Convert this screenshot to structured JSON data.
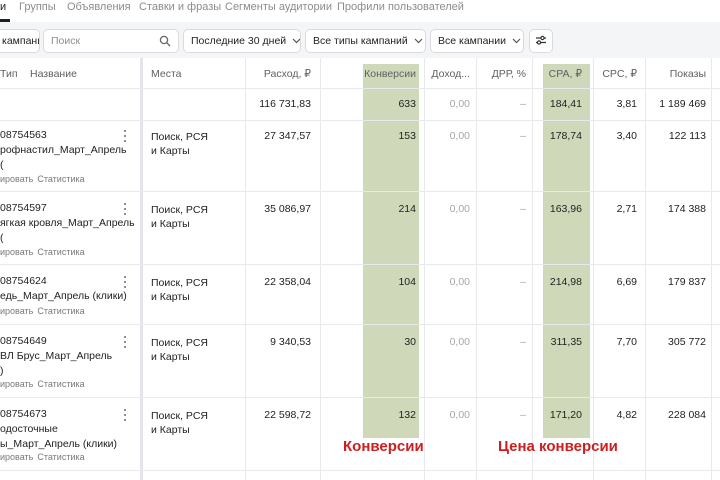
{
  "tabs": [
    {
      "label": "и",
      "active": true
    },
    {
      "label": "Группы"
    },
    {
      "label": "Объявления"
    },
    {
      "label": "Ставки и фразы"
    },
    {
      "label": "Сегменты аудитории"
    },
    {
      "label": "Профили пользователей"
    }
  ],
  "filters": {
    "add_campaign_label": "кампанию",
    "search_placeholder": "Поиск",
    "period_label": "Последние 30 дней",
    "types_label": "Все типы кампаний",
    "campaigns_label": "Все кампании"
  },
  "columns": {
    "type": "Тип",
    "name": "Название",
    "places": "Места",
    "spend": "Расход, ₽",
    "conversions": "Конверсии",
    "income": "Доход...",
    "drr": "ДРР, %",
    "cpa": "CPA, ₽",
    "cpc": "CPC, ₽",
    "impressions": "Показы"
  },
  "totals": {
    "spend": "116 731,83",
    "conversions": "633",
    "income": "0,00",
    "drr": "–",
    "cpa": "184,41",
    "cpc": "3,81",
    "impressions": "1 189 469"
  },
  "rows": [
    {
      "id": "08754563",
      "name_lines": [
        "рофнастил_Март_Апрель",
        "("
      ],
      "link1": "ировать",
      "link2": "Статистика",
      "places": [
        "Поиск, РСЯ",
        "и Карты"
      ],
      "spend": "27 347,57",
      "conversions": "153",
      "income": "0,00",
      "drr": "–",
      "cpa": "178,74",
      "cpc": "3,40",
      "impressions": "122 113"
    },
    {
      "id": "08754597",
      "name_lines": [
        "ягкая кровля_Март_Апрель",
        "("
      ],
      "link1": "ировать",
      "link2": "Статистика",
      "places": [
        "Поиск, РСЯ",
        "и Карты"
      ],
      "spend": "35 086,97",
      "conversions": "214",
      "income": "0,00",
      "drr": "–",
      "cpa": "163,96",
      "cpc": "2,71",
      "impressions": "174 388"
    },
    {
      "id": "08754624",
      "name_lines": [
        "едь_Март_Апрель (клики)"
      ],
      "link1": "ировать",
      "link2": "Статистика",
      "places": [
        "Поиск, РСЯ",
        "и Карты"
      ],
      "spend": "22 358,04",
      "conversions": "104",
      "income": "0,00",
      "drr": "–",
      "cpa": "214,98",
      "cpc": "6,69",
      "impressions": "179 837"
    },
    {
      "id": "08754649",
      "name_lines": [
        "ВЛ Брус_Март_Апрель",
        ")"
      ],
      "link1": "ировать",
      "link2": "Статистика",
      "places": [
        "Поиск, РСЯ",
        "и Карты"
      ],
      "spend": "9 340,53",
      "conversions": "30",
      "income": "0,00",
      "drr": "–",
      "cpa": "311,35",
      "cpc": "7,70",
      "impressions": "305 772"
    },
    {
      "id": "08754673",
      "name_lines": [
        "одосточные",
        "ы_Март_Апрель (клики)"
      ],
      "link1": "ировать",
      "link2": "Статистика",
      "places": [
        "Поиск, РСЯ",
        "и Карты"
      ],
      "spend": "22 598,72",
      "conversions": "132",
      "income": "0,00",
      "drr": "–",
      "cpa": "171,20",
      "cpc": "4,82",
      "impressions": "228 084"
    }
  ],
  "annotations": {
    "conversions": "Конверсии",
    "cpa": "Цена конверсии"
  },
  "colors": {
    "highlight": "#c3d0a9",
    "annotation": "#cc1f1f",
    "filterbar_bg": "#f4f5f7"
  }
}
